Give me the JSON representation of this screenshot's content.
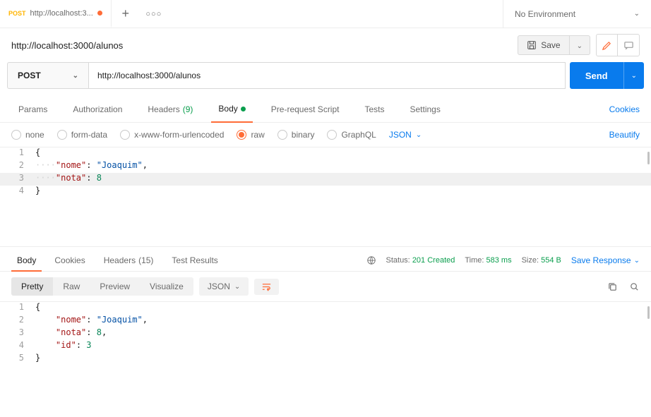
{
  "tab": {
    "method": "POST",
    "title": "http://localhost:3..."
  },
  "env": {
    "label": "No Environment"
  },
  "request": {
    "displayTitle": "http://localhost:3000/alunos",
    "save": "Save",
    "method": "POST",
    "url": "http://localhost:3000/alunos",
    "send": "Send"
  },
  "reqTabs": {
    "params": "Params",
    "auth": "Authorization",
    "headers": "Headers",
    "headersCount": "(9)",
    "body": "Body",
    "prereq": "Pre-request Script",
    "tests": "Tests",
    "settings": "Settings",
    "cookies": "Cookies"
  },
  "bodyTypes": {
    "none": "none",
    "formdata": "form-data",
    "xwww": "x-www-form-urlencoded",
    "raw": "raw",
    "binary": "binary",
    "graphql": "GraphQL",
    "json": "JSON",
    "beautify": "Beautify"
  },
  "reqBody": {
    "line1": "{",
    "line2_ws": "····",
    "line2_key": "\"nome\"",
    "line2_sep": ": ",
    "line2_val": "\"Joaquim\"",
    "line2_end": ",",
    "line3_ws": "····",
    "line3_key": "\"nota\"",
    "line3_sep": ": ",
    "line3_val": "8",
    "line4": "}"
  },
  "respTabs": {
    "body": "Body",
    "cookies": "Cookies",
    "headers": "Headers",
    "headersCount": "(15)",
    "tests": "Test Results"
  },
  "respMeta": {
    "statusLabel": "Status:",
    "statusVal": "201 Created",
    "timeLabel": "Time:",
    "timeVal": "583 ms",
    "sizeLabel": "Size:",
    "sizeVal": "554 B",
    "saveResp": "Save Response"
  },
  "respToolbar": {
    "pretty": "Pretty",
    "raw": "Raw",
    "preview": "Preview",
    "visualize": "Visualize",
    "json": "JSON"
  },
  "respBody": {
    "line1": "{",
    "line2_key": "\"nome\"",
    "line2_sep": ": ",
    "line2_val": "\"Joaquim\"",
    "line2_end": ",",
    "line3_key": "\"nota\"",
    "line3_sep": ": ",
    "line3_val": "8",
    "line3_end": ",",
    "line4_key": "\"id\"",
    "line4_sep": ": ",
    "line4_val": "3",
    "line5": "}"
  }
}
